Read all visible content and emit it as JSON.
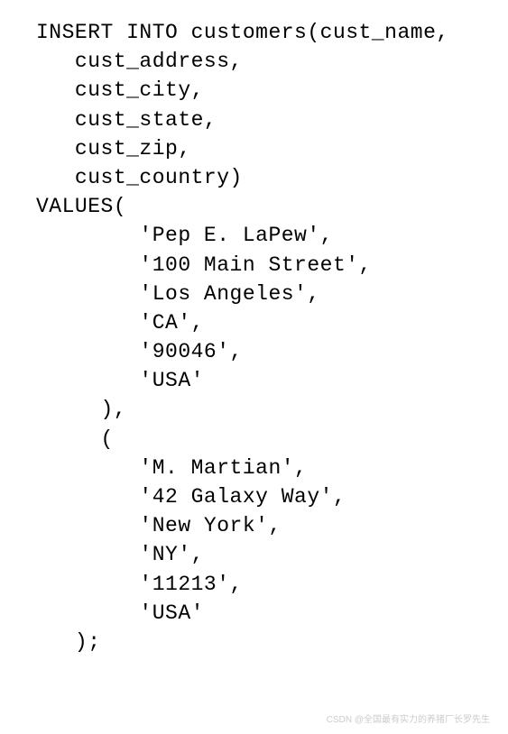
{
  "code": {
    "line1": "INSERT INTO customers(cust_name,",
    "line2": "   cust_address,",
    "line3": "   cust_city,",
    "line4": "   cust_state,",
    "line5": "   cust_zip,",
    "line6": "   cust_country)",
    "line7": "VALUES(",
    "line8": "        'Pep E. LaPew',",
    "line9": "        '100 Main Street',",
    "line10": "        'Los Angeles',",
    "line11": "        'CA',",
    "line12": "        '90046',",
    "line13": "        'USA'",
    "line14": "     ),",
    "line15": "     (",
    "line16": "        'M. Martian',",
    "line17": "        '42 Galaxy Way',",
    "line18": "        'New York',",
    "line19": "        'NY',",
    "line20": "        '11213',",
    "line21": "        'USA'",
    "line22": "   );"
  },
  "watermark": "CSDN @全国最有实力的养猪厂长罗先生"
}
